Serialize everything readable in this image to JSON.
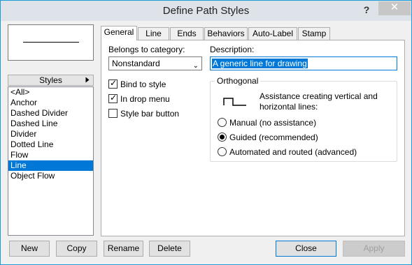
{
  "window": {
    "title": "Define Path Styles",
    "help": "?",
    "close": "✕"
  },
  "styles": {
    "header": "Styles",
    "items": [
      "<All>",
      "Anchor",
      "Dashed Divider",
      "Dashed Line",
      "Divider",
      "Dotted Line",
      "Flow",
      "Line",
      "Object Flow"
    ],
    "selected": "Line"
  },
  "tabs": [
    "General",
    "Line",
    "Ends",
    "Behaviors",
    "Auto-Label",
    "Stamp"
  ],
  "general": {
    "category_label": "Belongs to category:",
    "category_value": "Nonstandard",
    "description_label": "Description:",
    "description_value": "A generic line for drawing",
    "checks": [
      {
        "label": "Bind to style",
        "checked": true
      },
      {
        "label": "In drop menu",
        "checked": true
      },
      {
        "label": "Style bar button",
        "checked": false
      }
    ],
    "orthogonal": {
      "title": "Orthogonal",
      "text": "Assistance creating vertical and horizontal lines:",
      "options": [
        "Manual (no assistance)",
        "Guided (recommended)",
        "Automated and routed (advanced)"
      ],
      "selected": "Guided (recommended)"
    }
  },
  "buttons": {
    "new": "New",
    "copy": "Copy",
    "rename": "Rename",
    "delete": "Delete",
    "close": "Close",
    "apply": "Apply"
  }
}
